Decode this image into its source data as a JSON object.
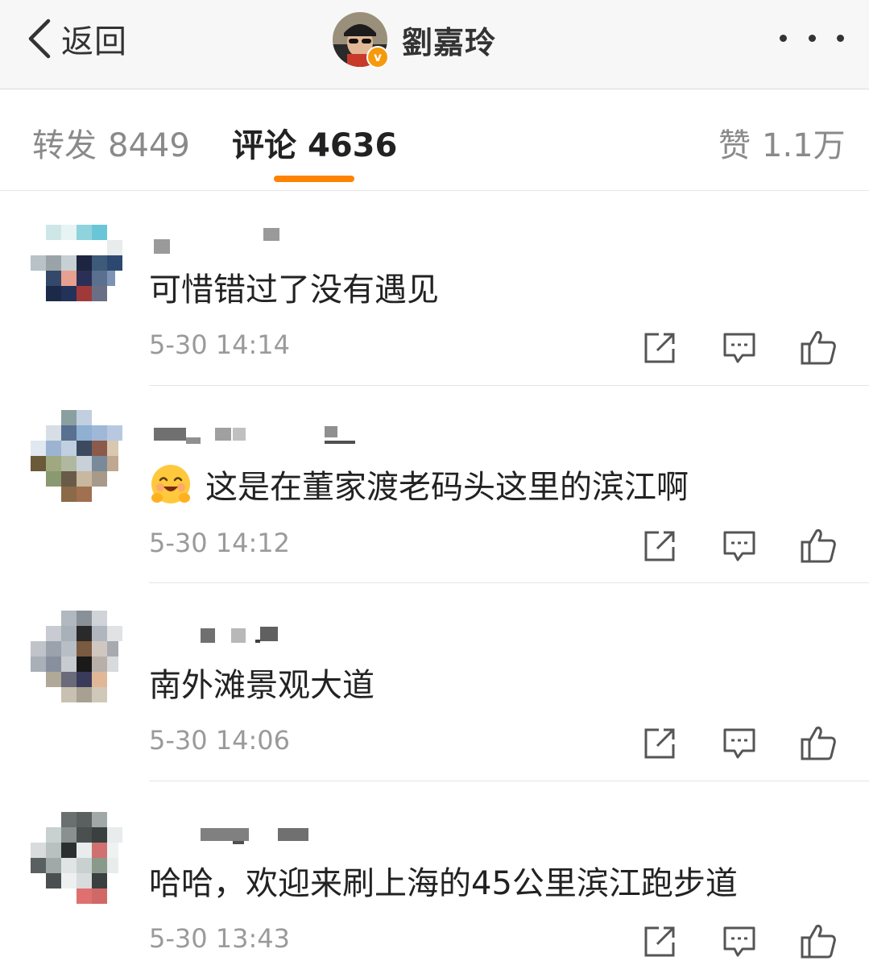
{
  "nav": {
    "back_label": "返回",
    "user_name": "劉嘉玲",
    "verified_badge": "v",
    "back_icon": "chevron-left-icon",
    "more_icon": "more-dots-icon"
  },
  "tabs": {
    "repost": {
      "label": "转发",
      "count": "8449"
    },
    "comment": {
      "label": "评论",
      "count": "4636"
    },
    "like": {
      "label": "赞",
      "count": "1.1万"
    },
    "active": "comment",
    "accent_color": "#ff8200"
  },
  "comments": [
    {
      "text": "可惜错过了没有遇见",
      "time": "5-30 14:14",
      "emoji": ""
    },
    {
      "text": "这是在董家渡老码头这里的滨江啊",
      "time": "5-30 14:12",
      "emoji": "smiling-hug-emoji"
    },
    {
      "text": "南外滩景观大道",
      "time": "5-30 14:06",
      "emoji": ""
    },
    {
      "text": "哈哈，欢迎来刷上海的45公里滨江跑步道",
      "time": "5-30 13:43",
      "emoji": ""
    }
  ],
  "action_icons": [
    "share-icon",
    "comment-icon",
    "thumbs-up-icon"
  ]
}
